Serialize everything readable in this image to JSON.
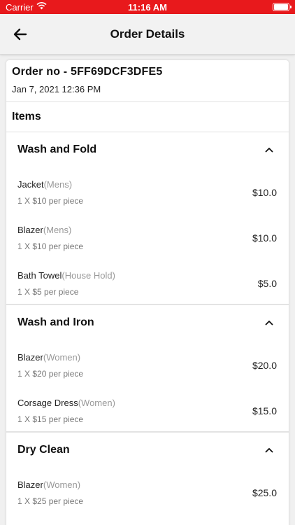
{
  "status_bar": {
    "carrier": "Carrier",
    "time": "11:16 AM"
  },
  "nav": {
    "title": "Order Details",
    "back_icon": "arrow-left-icon"
  },
  "order": {
    "number": "Order no - 5FF69DCF3DFE5",
    "date": "Jan 7, 2021 12:36 PM"
  },
  "items_label": "Items",
  "sections": [
    {
      "title": "Wash and Fold",
      "items": [
        {
          "name": "Jacket",
          "category": "(Mens)",
          "qty": "1 X $10 per piece",
          "price": "$10.0"
        },
        {
          "name": "Blazer",
          "category": "(Mens)",
          "qty": "1 X $10 per piece",
          "price": "$10.0"
        },
        {
          "name": "Bath Towel",
          "category": "(House Hold)",
          "qty": "1 X $5 per piece",
          "price": "$5.0"
        }
      ]
    },
    {
      "title": "Wash and Iron",
      "items": [
        {
          "name": "Blazer",
          "category": "(Women)",
          "qty": "1 X $20 per piece",
          "price": "$20.0"
        },
        {
          "name": "Corsage Dress",
          "category": "(Women)",
          "qty": "1 X $15 per piece",
          "price": "$15.0"
        }
      ]
    },
    {
      "title": "Dry Clean",
      "items": [
        {
          "name": "Blazer",
          "category": "(Women)",
          "qty": "1 X $25 per piece",
          "price": "$25.0"
        }
      ]
    }
  ],
  "colors": {
    "accent": "#e8191c"
  }
}
